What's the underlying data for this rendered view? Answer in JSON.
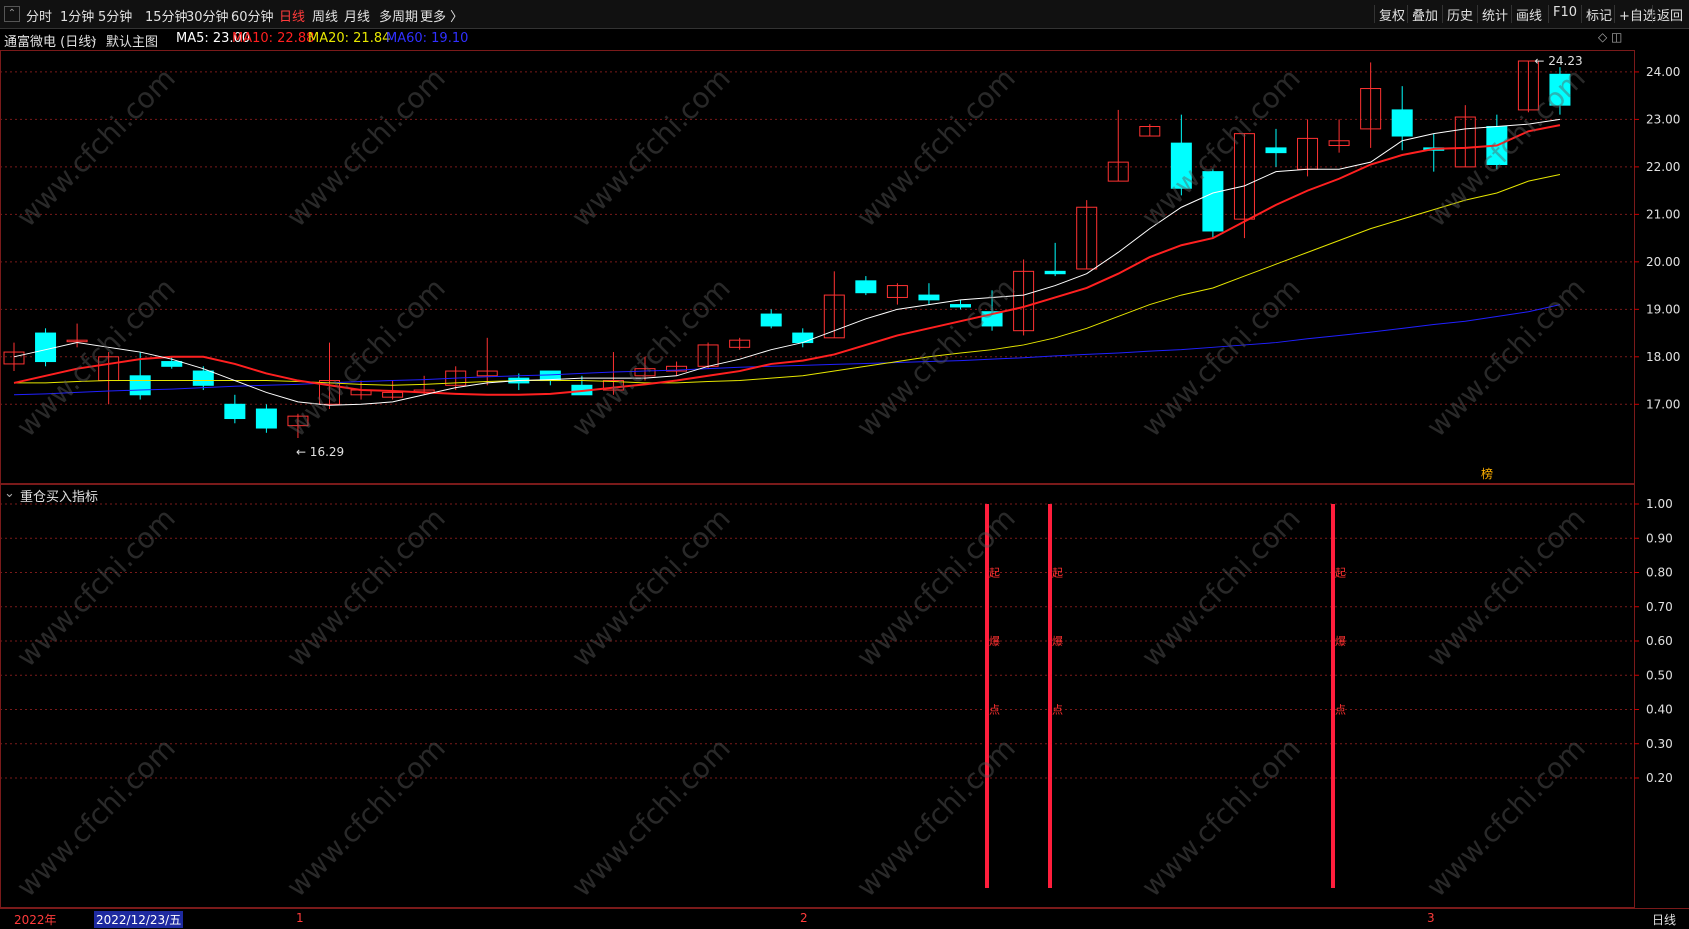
{
  "toolbar": {
    "periods": [
      "分时",
      "1分钟",
      "5分钟",
      "15分钟",
      "30分钟",
      "60分钟",
      "日线",
      "周线",
      "月线",
      "多周期",
      "更多 〉"
    ],
    "active_period": "日线",
    "right_buttons": [
      "复权",
      "叠加",
      "历史",
      "统计",
      "画线",
      "F10",
      "标记",
      "+自选",
      "返回"
    ]
  },
  "info": {
    "stock": "通富微电 (日线)",
    "template": "默认主图",
    "ma5": "MA5: 23.00",
    "ma10": "MA10: 22.88",
    "ma20": "MA20: 21.84",
    "ma60": "MA60: 19.10"
  },
  "colors": {
    "up": "#ff3232",
    "down": "#00ffff",
    "ma5": "#ffffff",
    "ma10": "#ff2020",
    "ma20": "#e6e600",
    "ma60": "#2020ff",
    "grid": "#7a1a1a"
  },
  "chart_data": [
    {
      "type": "candlestick",
      "y_ticks": [
        "24.00",
        "23.00",
        "22.00",
        "21.00",
        "20.00",
        "19.00",
        "18.00",
        "17.00"
      ],
      "ylim": [
        16.0,
        24.6
      ],
      "annotations": {
        "high_label": "24.23",
        "low_label": "16.29",
        "badge": "榜"
      },
      "candles": [
        [
          17.85,
          18.1,
          17.7,
          18.3
        ],
        [
          18.5,
          17.9,
          17.8,
          18.6
        ],
        [
          18.35,
          18.35,
          18.2,
          18.7
        ],
        [
          17.5,
          18.0,
          17.0,
          18.1
        ],
        [
          17.6,
          17.2,
          17.1,
          18.1
        ],
        [
          17.9,
          17.8,
          17.75,
          18.0
        ],
        [
          17.7,
          17.4,
          17.3,
          17.8
        ],
        [
          17.0,
          16.7,
          16.6,
          17.2
        ],
        [
          16.9,
          16.5,
          16.4,
          17.0
        ],
        [
          16.55,
          16.75,
          16.29,
          16.8
        ],
        [
          17.0,
          17.5,
          16.9,
          18.3
        ],
        [
          17.2,
          17.3,
          17.1,
          17.5
        ],
        [
          17.15,
          17.25,
          17.1,
          17.5
        ],
        [
          17.25,
          17.3,
          17.2,
          17.6
        ],
        [
          17.4,
          17.7,
          17.3,
          17.8
        ],
        [
          17.6,
          17.7,
          17.4,
          18.4
        ],
        [
          17.55,
          17.45,
          17.3,
          17.65
        ],
        [
          17.7,
          17.5,
          17.4,
          17.7
        ],
        [
          17.4,
          17.2,
          17.2,
          17.6
        ],
        [
          17.3,
          17.5,
          17.2,
          18.1
        ],
        [
          17.6,
          17.75,
          17.5,
          18.0
        ],
        [
          17.7,
          17.8,
          17.6,
          17.9
        ],
        [
          17.8,
          18.25,
          17.75,
          18.3
        ],
        [
          18.2,
          18.35,
          18.15,
          18.4
        ],
        [
          18.9,
          18.65,
          18.6,
          19.0
        ],
        [
          18.5,
          18.3,
          18.2,
          18.6
        ],
        [
          18.4,
          19.3,
          18.4,
          19.8
        ],
        [
          19.6,
          19.35,
          19.3,
          19.7
        ],
        [
          19.25,
          19.5,
          19.1,
          19.55
        ],
        [
          19.3,
          19.2,
          19.1,
          19.55
        ],
        [
          19.1,
          19.05,
          19.0,
          19.2
        ],
        [
          18.95,
          18.65,
          18.55,
          19.4
        ],
        [
          18.55,
          19.8,
          18.45,
          20.05
        ],
        [
          19.8,
          19.75,
          19.7,
          20.4
        ],
        [
          19.85,
          21.15,
          19.85,
          21.3
        ],
        [
          21.7,
          22.1,
          21.7,
          23.2
        ],
        [
          22.65,
          22.85,
          22.65,
          22.9
        ],
        [
          22.5,
          21.55,
          21.4,
          23.1
        ],
        [
          21.9,
          20.65,
          20.5,
          21.95
        ],
        [
          20.9,
          22.7,
          20.5,
          22.7
        ],
        [
          22.4,
          22.3,
          22.0,
          22.8
        ],
        [
          21.95,
          22.6,
          21.8,
          23.0
        ],
        [
          22.45,
          22.55,
          22.3,
          23.0
        ],
        [
          22.8,
          23.65,
          22.4,
          24.2
        ],
        [
          23.2,
          22.65,
          22.35,
          23.7
        ],
        [
          22.4,
          22.35,
          21.9,
          22.7
        ],
        [
          22.0,
          23.05,
          22.0,
          23.3
        ],
        [
          22.85,
          22.05,
          21.95,
          23.1
        ],
        [
          23.2,
          24.23,
          23.15,
          24.23
        ],
        [
          23.95,
          23.3,
          23.1,
          24.1
        ]
      ],
      "ma5": [
        18.0,
        18.15,
        18.3,
        18.2,
        18.1,
        17.95,
        17.75,
        17.5,
        17.25,
        17.05,
        16.98,
        17.0,
        17.05,
        17.2,
        17.35,
        17.45,
        17.5,
        17.52,
        17.55,
        17.55,
        17.55,
        17.6,
        17.8,
        17.95,
        18.15,
        18.3,
        18.55,
        18.8,
        19.0,
        19.1,
        19.2,
        19.25,
        19.3,
        19.5,
        19.75,
        20.2,
        20.7,
        21.15,
        21.45,
        21.6,
        21.9,
        21.95,
        21.95,
        22.1,
        22.55,
        22.7,
        22.8,
        22.85,
        22.9,
        23.0
      ],
      "ma10": [
        17.45,
        17.6,
        17.75,
        17.85,
        17.95,
        18.0,
        18.0,
        17.85,
        17.65,
        17.5,
        17.4,
        17.3,
        17.28,
        17.25,
        17.22,
        17.2,
        17.2,
        17.22,
        17.28,
        17.35,
        17.42,
        17.5,
        17.6,
        17.7,
        17.85,
        17.92,
        18.05,
        18.25,
        18.45,
        18.6,
        18.75,
        18.9,
        19.05,
        19.25,
        19.45,
        19.75,
        20.1,
        20.35,
        20.5,
        20.85,
        21.2,
        21.5,
        21.75,
        22.05,
        22.25,
        22.38,
        22.4,
        22.45,
        22.75,
        22.88
      ],
      "ma20": [
        17.45,
        17.45,
        17.48,
        17.5,
        17.5,
        17.5,
        17.5,
        17.5,
        17.5,
        17.48,
        17.45,
        17.42,
        17.4,
        17.42,
        17.45,
        17.48,
        17.5,
        17.5,
        17.5,
        17.48,
        17.45,
        17.45,
        17.48,
        17.5,
        17.55,
        17.6,
        17.7,
        17.8,
        17.9,
        18.0,
        18.08,
        18.15,
        18.25,
        18.4,
        18.6,
        18.85,
        19.1,
        19.3,
        19.45,
        19.7,
        19.95,
        20.2,
        20.45,
        20.7,
        20.9,
        21.1,
        21.3,
        21.45,
        21.7,
        21.84
      ],
      "ma60": [
        17.2,
        17.22,
        17.25,
        17.28,
        17.3,
        17.32,
        17.35,
        17.38,
        17.4,
        17.42,
        17.45,
        17.48,
        17.5,
        17.52,
        17.55,
        17.58,
        17.6,
        17.62,
        17.65,
        17.68,
        17.7,
        17.72,
        17.75,
        17.78,
        17.8,
        17.82,
        17.84,
        17.86,
        17.88,
        17.9,
        17.92,
        17.95,
        17.98,
        18.02,
        18.05,
        18.08,
        18.12,
        18.15,
        18.2,
        18.25,
        18.3,
        18.38,
        18.45,
        18.52,
        18.6,
        18.68,
        18.75,
        18.85,
        18.95,
        19.1
      ]
    },
    {
      "type": "bar",
      "title": "重仓买入指标",
      "y_ticks": [
        "1.00",
        "0.90",
        "0.80",
        "0.70",
        "0.60",
        "0.50",
        "0.40",
        "0.30",
        "0.20"
      ],
      "ylim": [
        0.0,
        1.02
      ],
      "signal_indices": [
        32,
        34,
        43
      ],
      "signal_value": 1.0,
      "signal_text": [
        "起",
        "爆",
        "点"
      ]
    }
  ],
  "datebar": {
    "year": "2022年",
    "cursor_date": "2022/12/23/五",
    "month_1": "1",
    "month_2": "2",
    "month_3": "3",
    "period": "日线"
  },
  "watermark": "www.cfchi.com",
  "corner_icons": "◇ ◫"
}
